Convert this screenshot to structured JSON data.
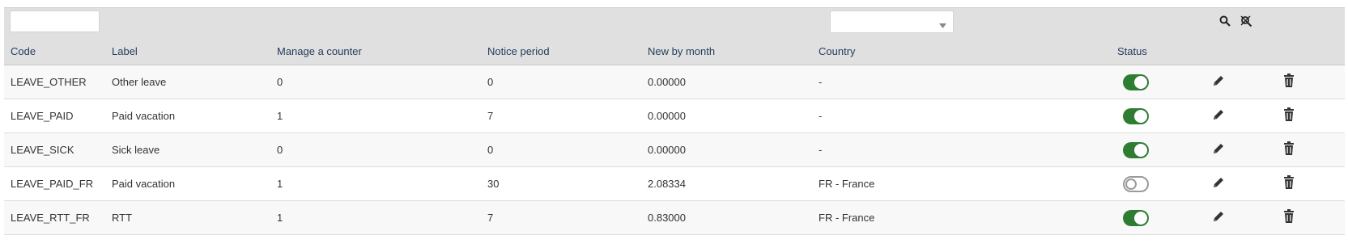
{
  "table": {
    "headers": {
      "code": "Code",
      "label": "Label",
      "manage_counter": "Manage a counter",
      "notice_period": "Notice period",
      "new_by_month": "New by month",
      "country": "Country",
      "status": "Status"
    },
    "filters": {
      "code_value": "",
      "country_selected": ""
    },
    "rows": [
      {
        "code": "LEAVE_OTHER",
        "label": "Other leave",
        "manage_counter": "0",
        "notice_period": "0",
        "new_by_month": "0.00000",
        "country": "-",
        "status": "on"
      },
      {
        "code": "LEAVE_PAID",
        "label": "Paid vacation",
        "manage_counter": "1",
        "notice_period": "7",
        "new_by_month": "0.00000",
        "country": "-",
        "status": "on"
      },
      {
        "code": "LEAVE_SICK",
        "label": "Sick leave",
        "manage_counter": "0",
        "notice_period": "0",
        "new_by_month": "0.00000",
        "country": "-",
        "status": "on"
      },
      {
        "code": "LEAVE_PAID_FR",
        "label": "Paid vacation",
        "manage_counter": "1",
        "notice_period": "30",
        "new_by_month": "2.08334",
        "country": "FR - France",
        "status": "off"
      },
      {
        "code": "LEAVE_RTT_FR",
        "label": "RTT",
        "manage_counter": "1",
        "notice_period": "7",
        "new_by_month": "0.83000",
        "country": "FR - France",
        "status": "on"
      }
    ]
  },
  "icons": {
    "search": "search-icon",
    "clear_filter": "clear-filter-icon",
    "edit": "pencil-icon",
    "delete": "trash-icon",
    "dropdown": "caret-down-icon"
  },
  "colors": {
    "header_bg": "#e0e0e0",
    "header_text": "#263c5c",
    "toggle_on": "#2e7d32",
    "toggle_off_border": "#9a9a9a"
  }
}
